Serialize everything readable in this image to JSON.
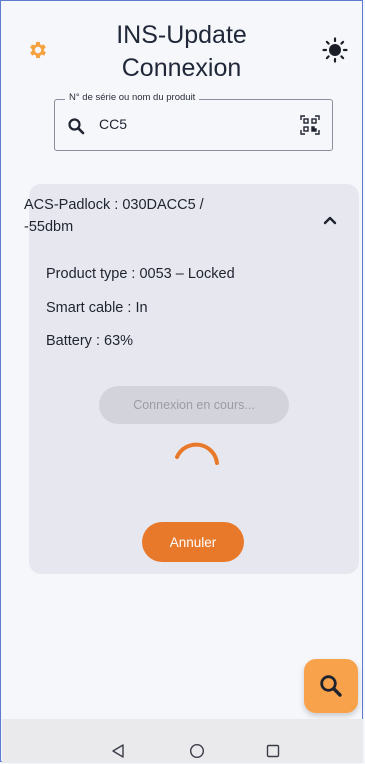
{
  "header": {
    "title_line1": "INS-Update",
    "title_line2": "Connexion",
    "settings_icon": "gear-icon",
    "theme_icon": "sun-icon",
    "accent": "#f8a34c"
  },
  "search": {
    "label": "N° de série ou nom du produit",
    "value": "CC5",
    "search_icon": "search-icon",
    "scan_icon": "qr-scan-icon"
  },
  "device": {
    "title_line1": "ACS-Padlock : 030DACC5 /",
    "title_line2": "-55dbm",
    "product_type": "Product type : 0053 – Locked",
    "smart_cable": "Smart cable : In",
    "battery": "Battery : 63%",
    "status_button": "Connexion en cours...",
    "cancel_button": "Annuler",
    "cancel_color": "#e8792b"
  },
  "fab": {
    "icon": "search-icon"
  },
  "navbar": {
    "back_icon": "back-triangle-icon",
    "home_icon": "home-circle-icon",
    "recent_icon": "recent-square-icon"
  }
}
